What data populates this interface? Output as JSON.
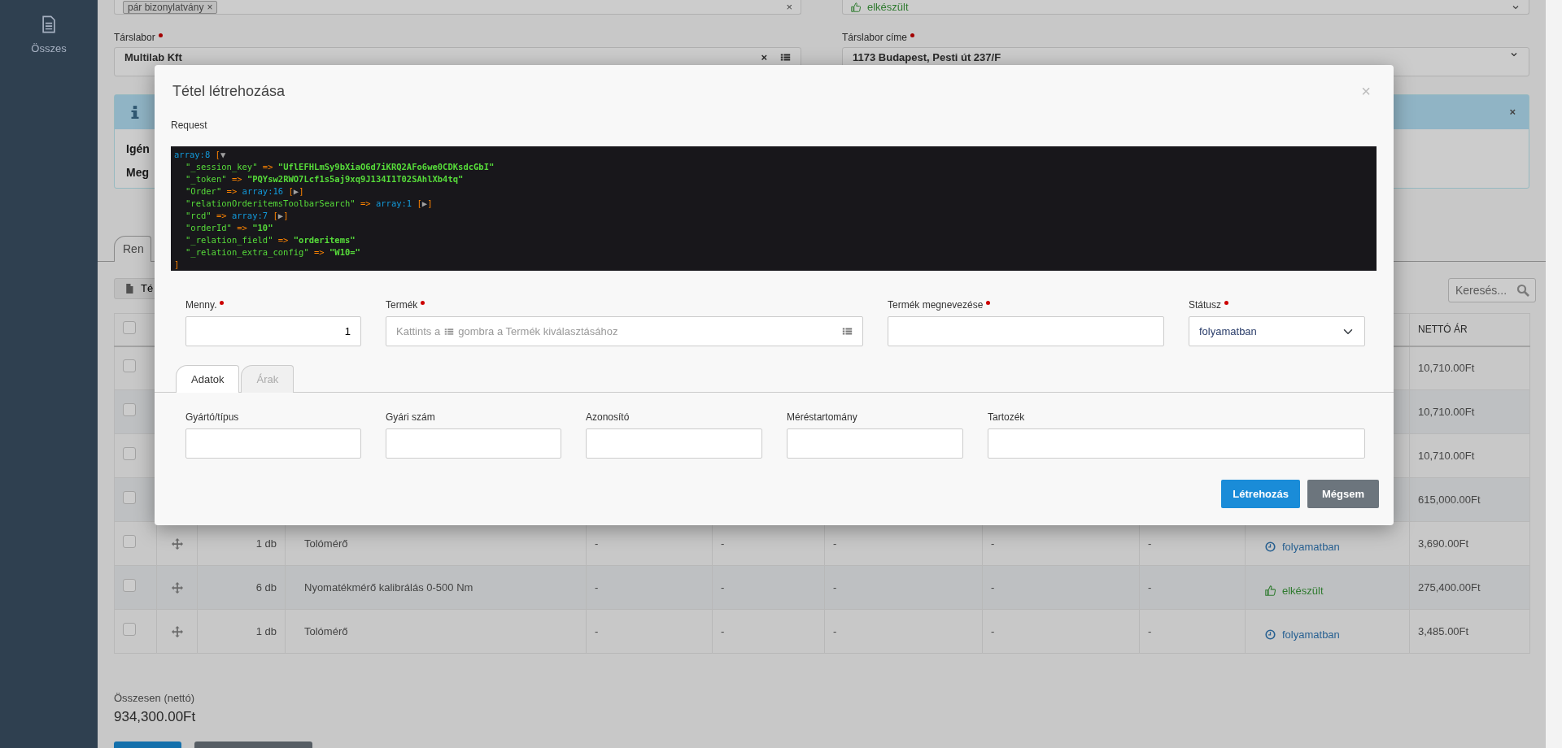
{
  "sidebar": {
    "items": [
      {
        "label": "Összes"
      }
    ]
  },
  "filters": [
    {
      "kind": "tags",
      "tags": [
        {
          "label": "pár bizonylatvány",
          "remove": "×"
        }
      ],
      "clear": "×"
    },
    {
      "kind": "select",
      "value": "elkészült"
    }
  ],
  "partner": {
    "label": "Társlabor",
    "required": true,
    "value": "Multilab Kft",
    "clear": "×"
  },
  "partner_address": {
    "label": "Társlabor címe",
    "required": true,
    "value": "1173 Budapest, Pesti út 237/F"
  },
  "alert": {
    "close": "×",
    "lines": [
      "Igén",
      "Meg"
    ]
  },
  "tabs": [
    {
      "label": "Ren",
      "selected": true
    }
  ],
  "toolbar": {
    "button": "Té",
    "search": {
      "placeholder": "Keresés..."
    }
  },
  "table": {
    "header_checked": false,
    "price_heading": "NETTÓ ÁR",
    "rows": [
      {
        "checked": false,
        "price": "10,710.00Ft"
      },
      {
        "checked": false,
        "price": "10,710.00Ft"
      },
      {
        "checked": false,
        "price": "10,710.00Ft"
      },
      {
        "checked": false,
        "price": "615,000.00Ft"
      },
      {
        "checked": false,
        "qty": "1 db",
        "name": "Tolómérő",
        "cells": [
          "-",
          "-",
          "-",
          "-",
          "-"
        ],
        "status": {
          "kind": "in_progress",
          "label": "folyamatban"
        },
        "price": "3,690.00Ft"
      },
      {
        "checked": false,
        "qty": "6 db",
        "name": "Nyomatékmérő kalibrálás 0-500 Nm",
        "cells": [
          "-",
          "-",
          "-",
          "-",
          "-"
        ],
        "status": {
          "kind": "done",
          "label": "elkészült"
        },
        "price": "275,400.00Ft"
      },
      {
        "checked": false,
        "qty": "1 db",
        "name": "Tolómérő",
        "cells": [
          "-",
          "-",
          "-",
          "-",
          "-"
        ],
        "status": {
          "kind": "in_progress",
          "label": "folyamatban"
        },
        "price": "3,485.00Ft"
      }
    ]
  },
  "total": {
    "label": "Összesen (nettó)",
    "value": "934,300.00Ft"
  },
  "modal": {
    "title": "Tétel létrehozása",
    "close": "×",
    "request_label": "Request",
    "dump": {
      "open": [
        {
          "text": "array:8",
          "kind": "note"
        },
        {
          "text": " [",
          "kind": "bracket"
        },
        {
          "text": "▼",
          "kind": "toggle"
        }
      ],
      "children": [
        {
          "segments": [
            {
              "text": "\"_session_key\"",
              "kind": "key"
            },
            {
              "text": " => ",
              "kind": "op"
            },
            {
              "text": "\"UflEFHLmSy9bXiaO6d7iKRQ2AFo6we0CDKsdcGbI\"",
              "kind": "string"
            }
          ]
        },
        {
          "segments": [
            {
              "text": "\"_token\"",
              "kind": "key"
            },
            {
              "text": " => ",
              "kind": "op"
            },
            {
              "text": "\"PQYsw2RWO7Lcf1s5aj9xq9J134I1T02SAhlXb4tq\"",
              "kind": "string"
            }
          ]
        },
        {
          "segments": [
            {
              "text": "\"Order\"",
              "kind": "key"
            },
            {
              "text": " => ",
              "kind": "op"
            },
            {
              "text": "array:16",
              "kind": "note"
            },
            {
              "text": " [",
              "kind": "bracket"
            },
            {
              "text": "▶",
              "kind": "toggle"
            },
            {
              "text": "]",
              "kind": "bracket"
            }
          ]
        },
        {
          "segments": [
            {
              "text": "\"relationOrderitemsToolbarSearch\"",
              "kind": "key"
            },
            {
              "text": " => ",
              "kind": "op"
            },
            {
              "text": "array:1",
              "kind": "note"
            },
            {
              "text": " [",
              "kind": "bracket"
            },
            {
              "text": "▶",
              "kind": "toggle"
            },
            {
              "text": "]",
              "kind": "bracket"
            }
          ]
        },
        {
          "segments": [
            {
              "text": "\"rcd\"",
              "kind": "key"
            },
            {
              "text": " => ",
              "kind": "op"
            },
            {
              "text": "array:7",
              "kind": "note"
            },
            {
              "text": " [",
              "kind": "bracket"
            },
            {
              "text": "▶",
              "kind": "toggle"
            },
            {
              "text": "]",
              "kind": "bracket"
            }
          ]
        },
        {
          "segments": [
            {
              "text": "\"orderId\"",
              "kind": "key"
            },
            {
              "text": " => ",
              "kind": "op"
            },
            {
              "text": "\"10\"",
              "kind": "string"
            }
          ]
        },
        {
          "segments": [
            {
              "text": "\"_relation_field\"",
              "kind": "key"
            },
            {
              "text": " => ",
              "kind": "op"
            },
            {
              "text": "\"orderitems\"",
              "kind": "string"
            }
          ]
        },
        {
          "segments": [
            {
              "text": "\"_relation_extra_config\"",
              "kind": "key"
            },
            {
              "text": " => ",
              "kind": "op"
            },
            {
              "text": "\"W10=\"",
              "kind": "string"
            }
          ]
        }
      ],
      "close": [
        {
          "text": "]",
          "kind": "bracket"
        }
      ]
    },
    "fields": [
      {
        "kind": "number",
        "label": "Menny.",
        "required": true,
        "value": "1"
      },
      {
        "kind": "picker",
        "label": "Termék",
        "required": true,
        "hint_before": "Kattints a",
        "hint_after": "gombra a Termék kiválasztásához"
      },
      {
        "kind": "text",
        "label": "Termék megnevezése",
        "required": true
      },
      {
        "kind": "select",
        "label": "Státusz",
        "required": true,
        "value": "folyamatban"
      }
    ],
    "tabs": [
      {
        "label": "Adatok",
        "selected": true
      },
      {
        "label": "Árak",
        "selected": false
      }
    ],
    "detail_fields": [
      {
        "label": "Gyártó/típus"
      },
      {
        "label": "Gyári szám"
      },
      {
        "label": "Azonosító"
      },
      {
        "label": "Méréstartomány"
      },
      {
        "label": "Tartozék"
      }
    ],
    "buttons": [
      {
        "kind": "primary",
        "label": "Létrehozás"
      },
      {
        "kind": "secondary",
        "label": "Mégsem"
      }
    ]
  }
}
